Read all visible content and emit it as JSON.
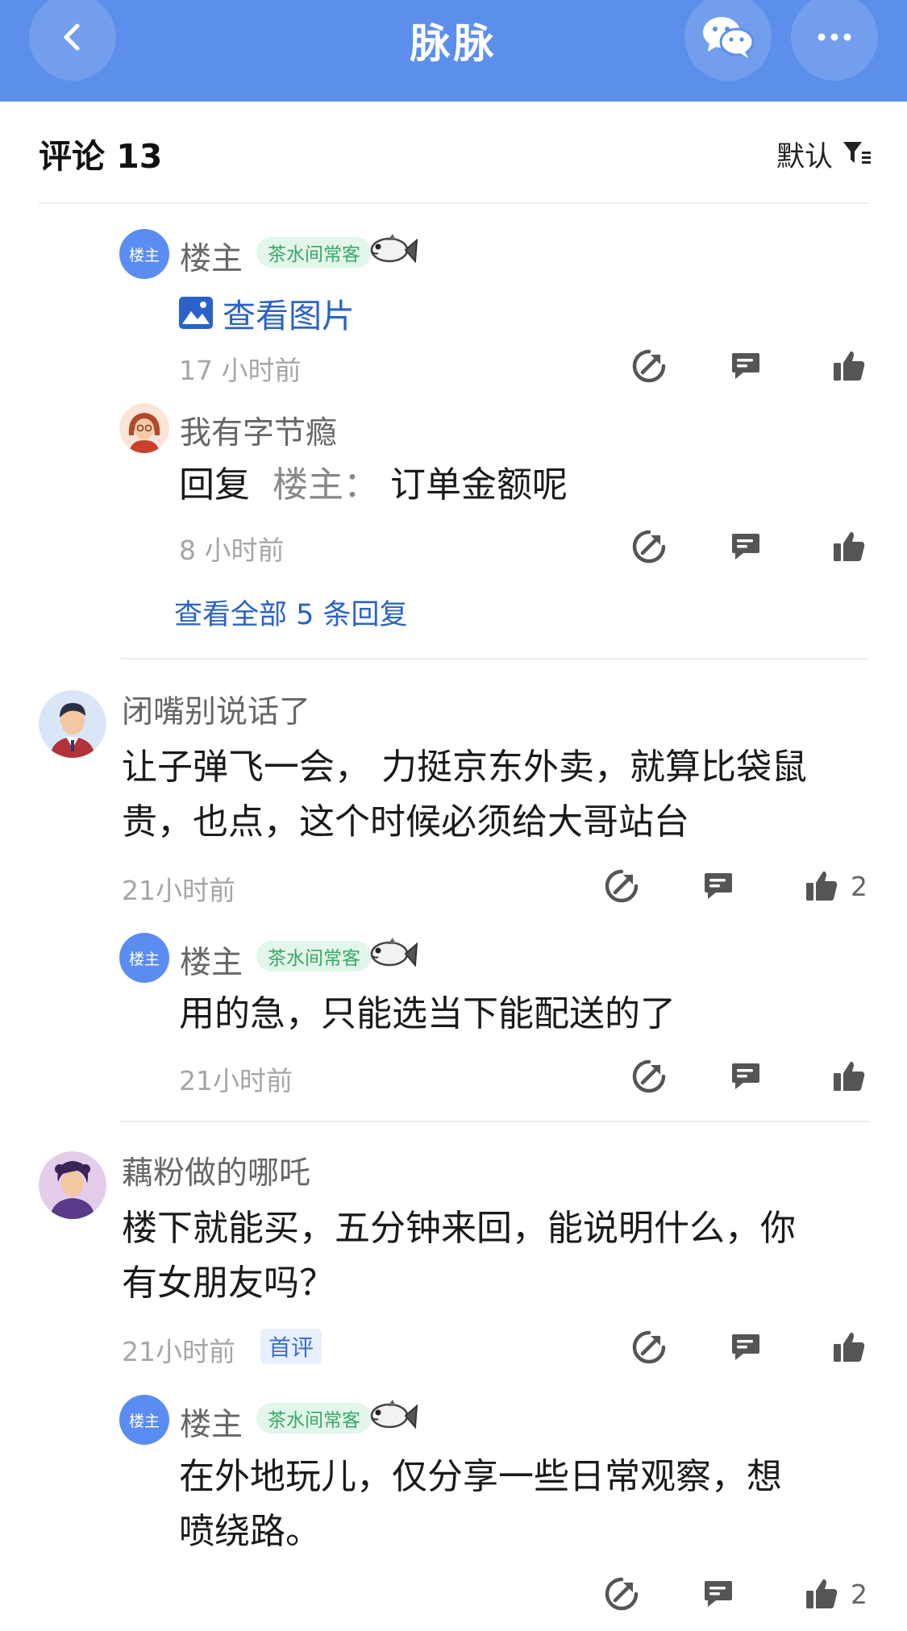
{
  "nav": {
    "title": "脉脉"
  },
  "header": {
    "title": "评论 13",
    "sort_label": "默认"
  },
  "comments": [
    {
      "replies": [
        {
          "author": "楼主",
          "author_avatar": "楼主",
          "tag": "茶水间常客",
          "image_link": "查看图片",
          "time": "17 小时前"
        },
        {
          "author": "我有字节瘾",
          "reply_prefix": "回复",
          "reply_target": "楼主：",
          "text": "订单金额呢",
          "time": "8 小时前"
        }
      ],
      "view_all": "查看全部 5 条回复"
    },
    {
      "author": "闭嘴别说话了",
      "text_lines": [
        "让子弹飞一会， 力挺京东外卖，就算比袋鼠",
        "贵，也点，这个时候必须给大哥站台"
      ],
      "time": "21小时前",
      "likes": "2",
      "replies": [
        {
          "author": "楼主",
          "author_avatar": "楼主",
          "tag": "茶水间常客",
          "text": "用的急，只能选当下能配送的了",
          "time": "21小时前"
        }
      ]
    },
    {
      "author": "藕粉做的哪吒",
      "text_lines": [
        "楼下就能买，五分钟来回，能说明什么，你",
        "有女朋友吗？"
      ],
      "time": "21小时前",
      "badge": "首评",
      "replies": [
        {
          "author": "楼主",
          "author_avatar": "楼主",
          "tag": "茶水间常客",
          "text_lines": [
            "在外地玩儿，仅分享一些日常观察，想",
            "喷绕路。"
          ],
          "likes": "2"
        }
      ]
    }
  ],
  "icons": {
    "back": "chevron-left-icon",
    "wechat": "wechat-icon",
    "more": "more-dots-icon",
    "filter": "filter-icon",
    "share": "share-arrow-icon",
    "comment": "comment-bubble-icon",
    "like": "thumbs-up-icon",
    "image": "image-icon",
    "fish": "fish-sticker-icon"
  },
  "colors": {
    "nav_bg": "#5c8eeb",
    "link": "#2a62c9",
    "tag_bg": "#e2f6ea",
    "tag_text": "#3aa868",
    "louzhu_badge": "#5b8df0"
  }
}
